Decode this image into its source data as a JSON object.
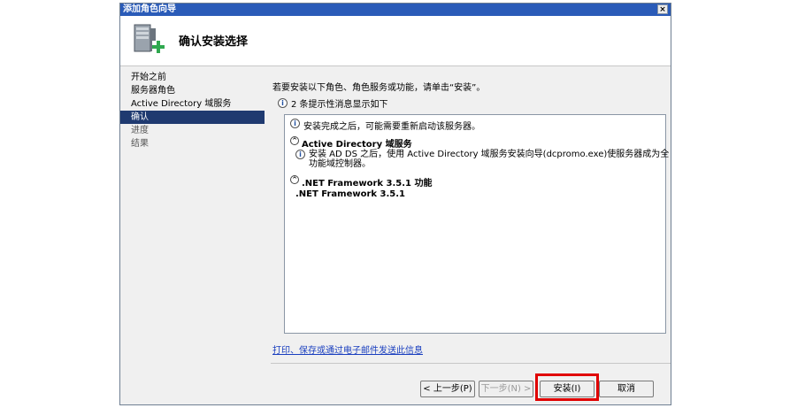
{
  "window": {
    "title": "添加角色向导",
    "close_glyph": "×"
  },
  "header": {
    "title": "确认安装选择"
  },
  "sidebar": {
    "items": [
      {
        "label": "开始之前"
      },
      {
        "label": "服务器角色"
      },
      {
        "label": "Active Directory 域服务"
      },
      {
        "label": "确认"
      },
      {
        "label": "进度"
      },
      {
        "label": "结果"
      }
    ]
  },
  "main": {
    "intro": "若要安装以下角色、角色服务或功能，请单击“安装”。",
    "info_count_text": "2 条提示性消息显示如下",
    "info_glyph": "i",
    "collapse_glyph": "^",
    "list": {
      "note1": "安装完成之后，可能需要重新启动该服务器。",
      "section1": "Active Directory 域服务",
      "section1_detail_line1": "安装 AD DS 之后，使用 Active Directory 域服务安装向导(dcpromo.exe)使服务器成为全",
      "section1_detail_line2": "功能域控制器。",
      "section2": ".NET Framework 3.5.1 功能",
      "section2_item": ".NET Framework 3.5.1"
    },
    "print_link": "打印、保存或通过电子邮件发送此信息"
  },
  "buttons": {
    "back": "< 上一步(P)",
    "next": "下一步(N) >",
    "install": "安装(I)",
    "cancel": "取消"
  },
  "colors": {
    "title_bar": "#2a5bb8",
    "nav_active": "#1f3a70",
    "highlight": "#e00000",
    "link": "#1a3fbf"
  }
}
